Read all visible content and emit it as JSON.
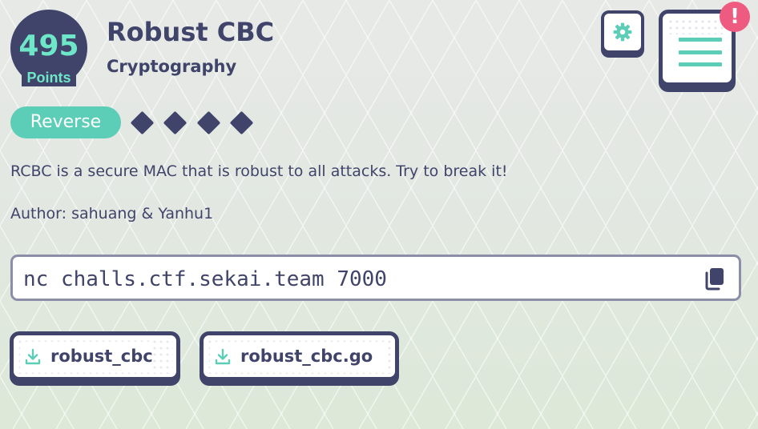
{
  "challenge": {
    "points_value": "495",
    "points_label": "Points",
    "title": "Robust CBC",
    "category": "Cryptography",
    "tag": "Reverse",
    "difficulty_level": 4,
    "description": "RCBC is a secure MAC that is robust to all attacks. Try to break it!",
    "author": "Author: sahuang & Yanhu1",
    "command": "nc challs.ctf.sekai.team 7000"
  },
  "header_actions": {
    "settings_icon": "gear-icon",
    "menu_icon": "hamburger-menu-icon",
    "alert_text": "!"
  },
  "files": [
    {
      "name": "robust_cbc",
      "icon": "download-icon"
    },
    {
      "name": "robust_cbc.go",
      "icon": "download-icon"
    }
  ],
  "colors": {
    "navy": "#40446a",
    "teal": "#5ccdb6",
    "points_text": "#6ee6c8",
    "alert": "#ee5a80",
    "background": "#e1e7e1"
  }
}
